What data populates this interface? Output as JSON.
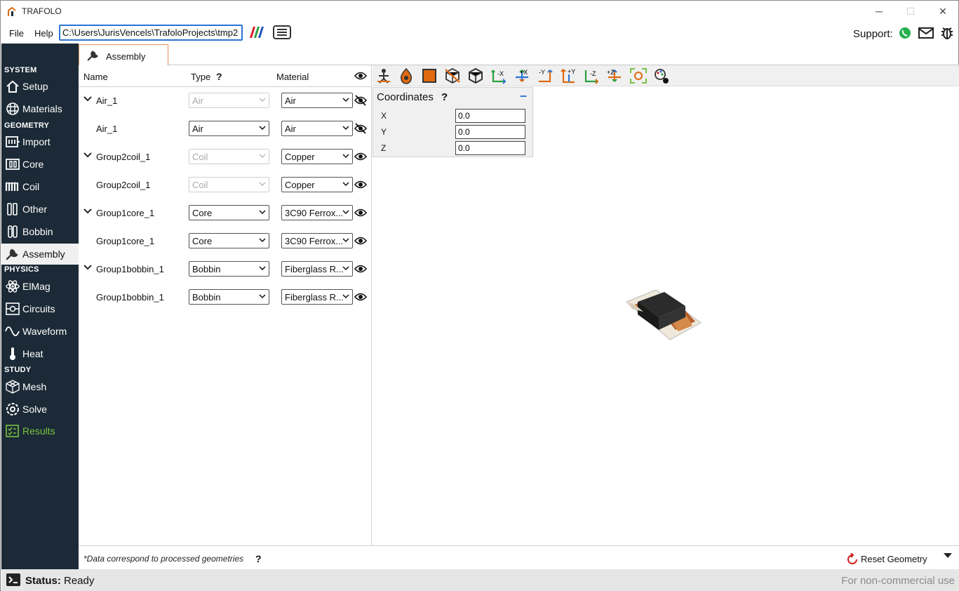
{
  "window": {
    "title": "TRAFOLO",
    "minimize": "─",
    "maximize": "☐",
    "close": "✕"
  },
  "menu": {
    "file": "File",
    "help": "Help",
    "project_path": "C:\\Users\\JurisVencels\\TrafoloProjects\\tmp2"
  },
  "support": {
    "label": "Support:",
    "icons": [
      "whatsapp-icon",
      "mail-icon",
      "bug-icon"
    ]
  },
  "sidebar": {
    "sections": {
      "system": "SYSTEM",
      "geometry": "GEOMETRY",
      "physics": "PHYSICS",
      "study": "STUDY"
    },
    "items": [
      {
        "label": "Setup",
        "icon": "home-icon"
      },
      {
        "label": "Materials",
        "icon": "grid-icon"
      },
      {
        "label": "Import",
        "icon": "import-icon"
      },
      {
        "label": "Core",
        "icon": "core-icon"
      },
      {
        "label": "Coil",
        "icon": "coil-icon"
      },
      {
        "label": "Other",
        "icon": "other-icon"
      },
      {
        "label": "Bobbin",
        "icon": "bobbin-icon"
      },
      {
        "label": "Assembly",
        "icon": "wrench-icon",
        "active": true
      },
      {
        "label": "ElMag",
        "icon": "atom-icon"
      },
      {
        "label": "Circuits",
        "icon": "circuit-icon"
      },
      {
        "label": "Waveform",
        "icon": "sine-icon"
      },
      {
        "label": "Heat",
        "icon": "thermometer-icon"
      },
      {
        "label": "Mesh",
        "icon": "mesh-icon"
      },
      {
        "label": "Solve",
        "icon": "solve-icon"
      },
      {
        "label": "Results",
        "icon": "results-icon",
        "accent": "#7ac142"
      }
    ]
  },
  "tab": {
    "label": "Assembly"
  },
  "table": {
    "headers": {
      "name": "Name",
      "type": "Type",
      "type_help": "?",
      "material": "Material"
    },
    "rows": [
      {
        "name": "Air_1",
        "type": "Air",
        "material": "Air",
        "expandable": true,
        "type_disabled": true,
        "visible": false
      },
      {
        "name": "Air_1",
        "type": "Air",
        "material": "Air",
        "expandable": false,
        "type_disabled": false,
        "visible": false
      },
      {
        "name": "Group2coil_1",
        "type": "Coil",
        "material": "Copper",
        "expandable": true,
        "type_disabled": true,
        "visible": true
      },
      {
        "name": "Group2coil_1",
        "type": "Coil",
        "material": "Copper",
        "expandable": false,
        "type_disabled": true,
        "visible": true
      },
      {
        "name": "Group1core_1",
        "type": "Core",
        "material": "3C90 Ferrox...",
        "expandable": true,
        "type_disabled": false,
        "visible": true
      },
      {
        "name": "Group1core_1",
        "type": "Core",
        "material": "3C90 Ferrox...",
        "expandable": false,
        "type_disabled": false,
        "visible": true
      },
      {
        "name": "Group1bobbin_1",
        "type": "Bobbin",
        "material": "Fiberglass R...",
        "expandable": true,
        "type_disabled": false,
        "visible": true
      },
      {
        "name": "Group1bobbin_1",
        "type": "Bobbin",
        "material": "Fiberglass R...",
        "expandable": false,
        "type_disabled": false,
        "visible": true
      }
    ]
  },
  "toolbar": {
    "buttons": [
      "pick-icon",
      "material-drop-icon",
      "solid-square-icon",
      "hide-selected-icon",
      "iso-view-icon",
      "view-minus-x-icon",
      "view-plus-x-icon",
      "view-minus-y-icon",
      "view-plus-y-icon",
      "view-minus-z-icon",
      "view-plus-z-icon",
      "fit-view-icon",
      "palette-icon"
    ],
    "axis_labels": [
      "-X",
      "+X",
      "-Y",
      "+Y",
      "-Z",
      "+Z"
    ]
  },
  "coordinates": {
    "title": "Coordinates",
    "help": "?",
    "collapse": "–",
    "x_label": "X",
    "y_label": "Y",
    "z_label": "Z",
    "x": "0.0",
    "y": "0.0",
    "z": "0.0"
  },
  "footer": {
    "note": "*Data correspond to processed geometries",
    "note_help": "?",
    "reset_label": "Reset Geometry"
  },
  "status": {
    "key": "Status:",
    "value": "Ready",
    "license": "For non-commercial use"
  },
  "colors": {
    "sidebar_bg": "#1b2a36",
    "accent_blue": "#2a74d4",
    "results_green": "#7ac142",
    "toolbar_orange": "#e06a10"
  }
}
